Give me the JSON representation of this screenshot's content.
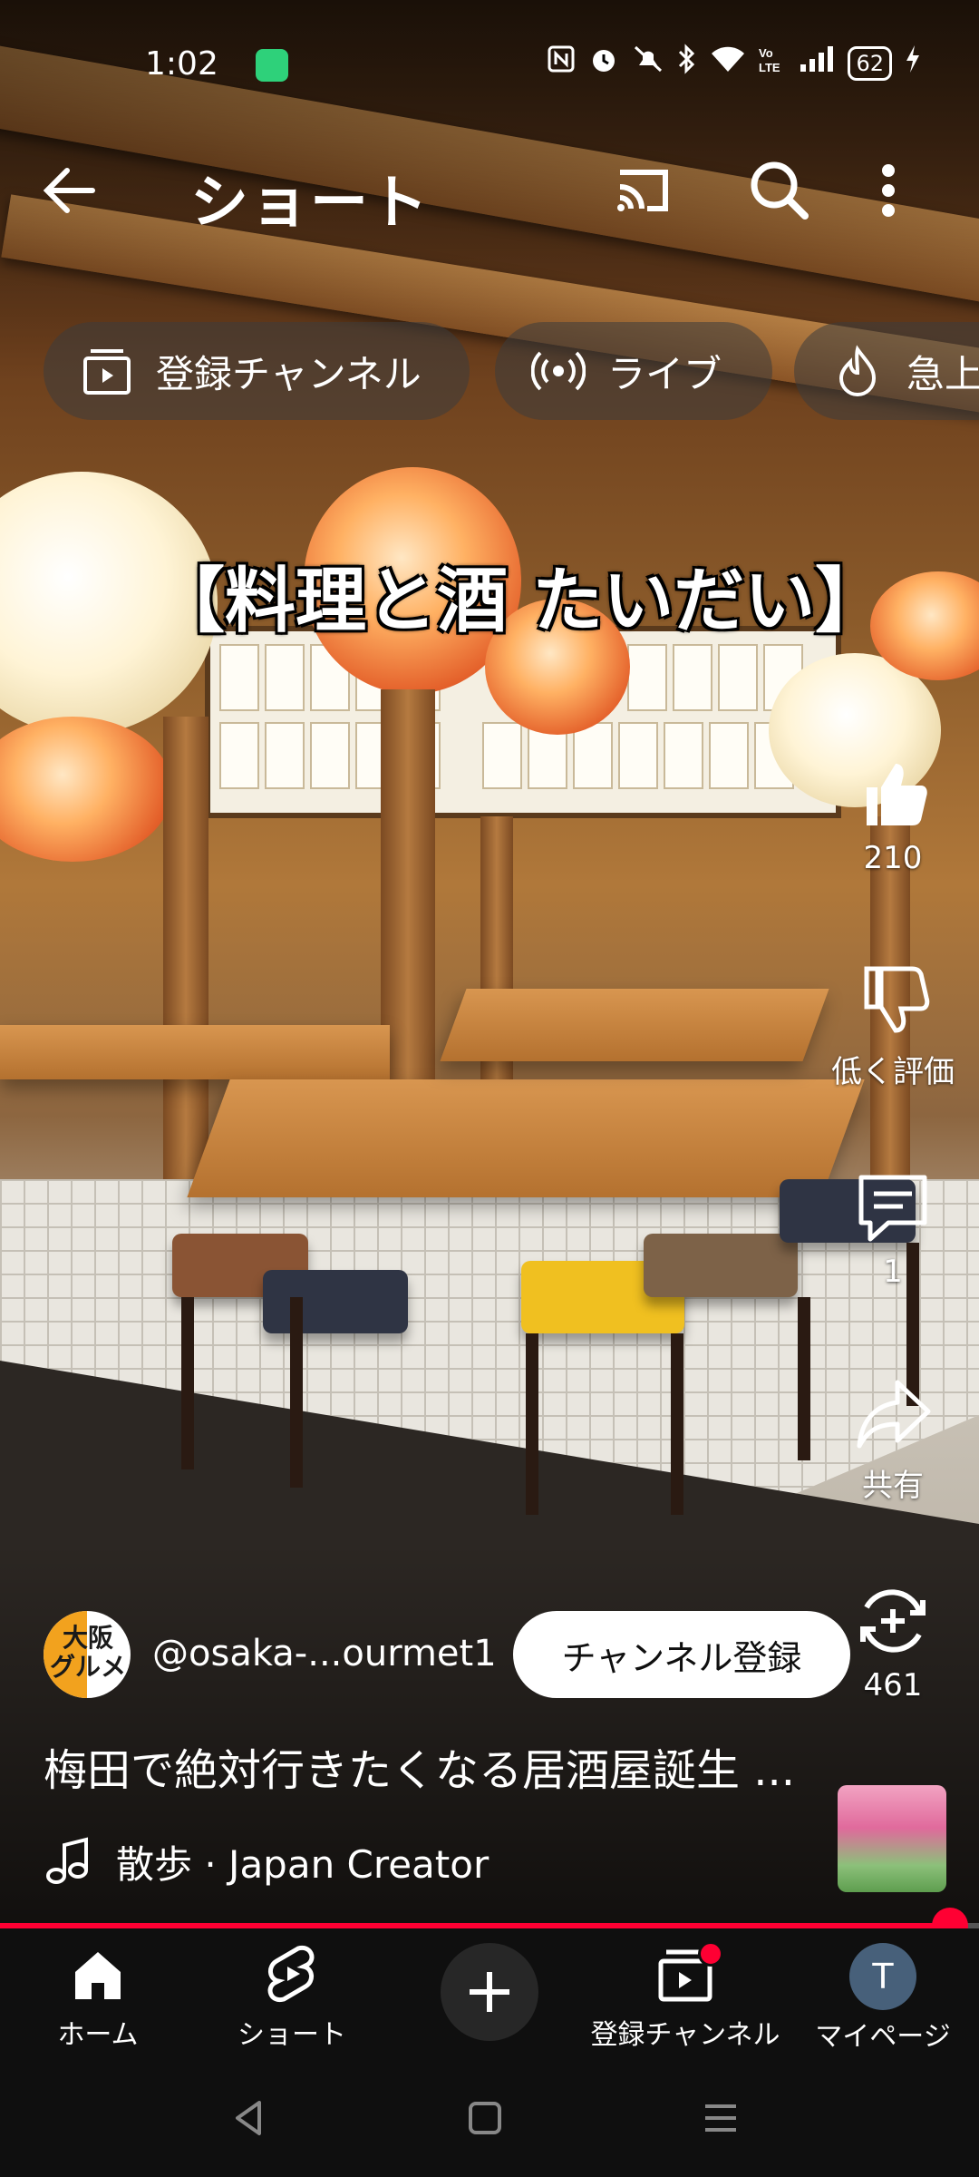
{
  "status_bar": {
    "time": "1:02",
    "battery": "62"
  },
  "top_bar": {
    "title": "ショート"
  },
  "chips": [
    {
      "label": "登録チャンネル",
      "icon": "subscriptions-icon"
    },
    {
      "label": "ライブ",
      "icon": "live-icon"
    },
    {
      "label": "急上",
      "icon": "trending-icon"
    }
  ],
  "video": {
    "overlay_text": "【料理と酒 たいだい】"
  },
  "actions": {
    "like_count": "210",
    "dislike_label": "低く評価",
    "comment_count": "1",
    "share_label": "共有",
    "remix_count": "461"
  },
  "channel": {
    "avatar_text": "大阪\nグルメ",
    "handle": "@osaka-...ourmet1",
    "subscribe_label": "チャンネル登録"
  },
  "description": "梅田で絶対行きたくなる居酒屋誕生 ...",
  "music": {
    "text": "散歩 · Japan Creator"
  },
  "progress": {
    "fraction": 0.97
  },
  "bottom_nav": {
    "home": "ホーム",
    "shorts": "ショート",
    "subscriptions": "登録チャンネル",
    "mypage": "マイページ",
    "avatar_letter": "T"
  },
  "colors": {
    "accent": "#ff0033",
    "nav_bg": "#0f0f0f"
  }
}
